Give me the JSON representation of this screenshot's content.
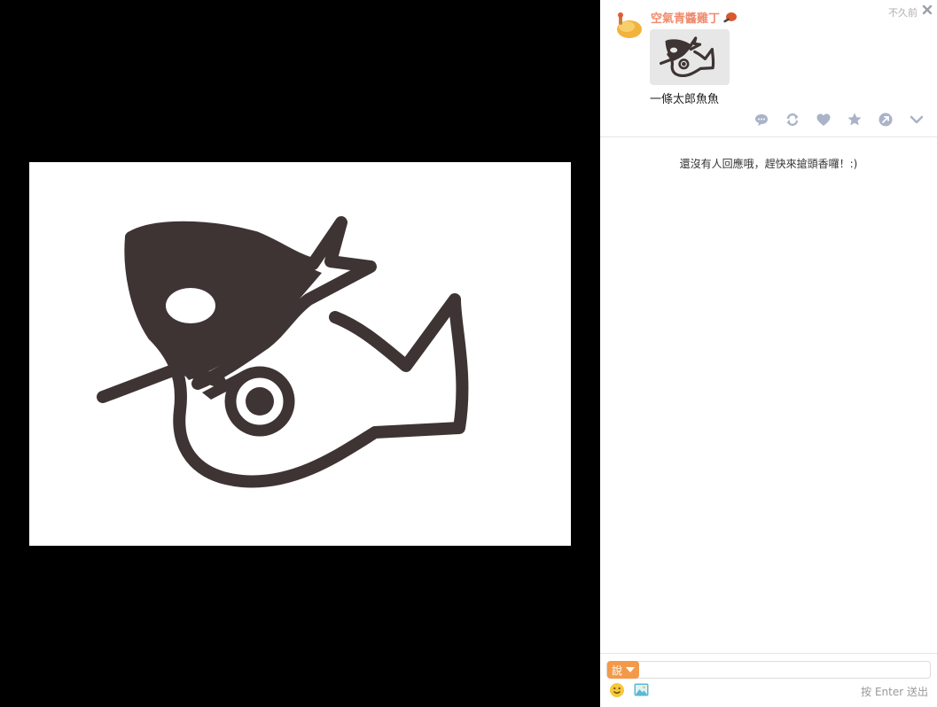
{
  "post": {
    "author": "空氣青醬雞丁",
    "time": "不久前",
    "caption": "一條太郎魚魚"
  },
  "comments": {
    "empty_message": "還沒有人回應哦，趕快來搶頭香囉！:)"
  },
  "composer": {
    "mode_label": "說",
    "hint": "按 Enter 送出"
  },
  "icons": {
    "close": "close-icon",
    "reply": "comment-icon",
    "repost": "repost-icon",
    "like": "heart-icon",
    "favorite": "star-icon",
    "share": "share-icon",
    "more": "chevron-down-icon",
    "emoji": "smiley-icon",
    "image": "image-icon"
  },
  "colors": {
    "accent": "#f08a6c",
    "action_icons": "#aab3c8",
    "say_button": "#f29a4a",
    "drawing_ink": "#3e3433"
  }
}
